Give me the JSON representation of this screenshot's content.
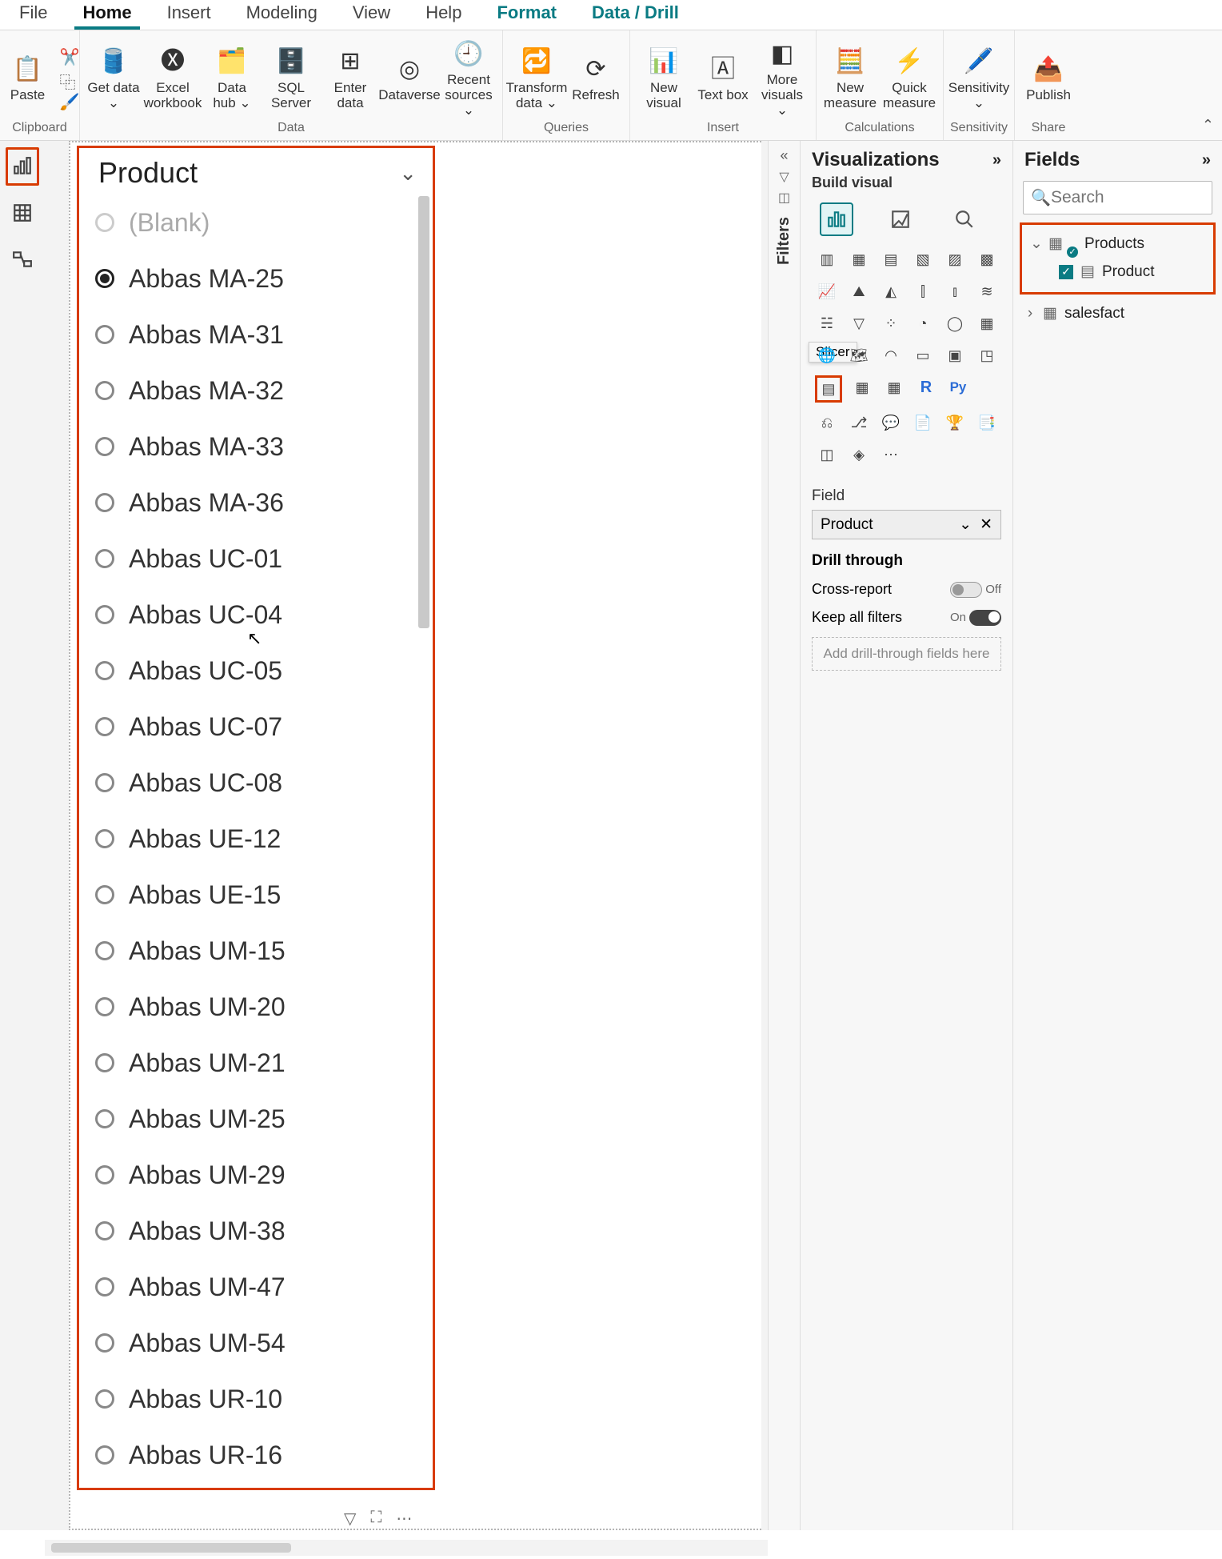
{
  "ribbon": {
    "tabs": [
      "File",
      "Home",
      "Insert",
      "Modeling",
      "View",
      "Help",
      "Format",
      "Data / Drill"
    ],
    "active": "Home",
    "groups": {
      "clipboard": {
        "label": "Clipboard",
        "paste": "Paste"
      },
      "data": {
        "label": "Data",
        "get": "Get data ⌄",
        "excel": "Excel workbook",
        "hub": "Data hub ⌄",
        "sql": "SQL Server",
        "enter": "Enter data",
        "dv": "Dataverse",
        "recent": "Recent sources ⌄"
      },
      "queries": {
        "label": "Queries",
        "transform": "Transform data ⌄",
        "refresh": "Refresh"
      },
      "insert": {
        "label": "Insert",
        "visual": "New visual",
        "text": "Text box",
        "more": "More visuals ⌄"
      },
      "calc": {
        "label": "Calculations",
        "measure": "New measure",
        "quick": "Quick measure"
      },
      "sens": {
        "label": "Sensitivity",
        "btn": "Sensitivity ⌄"
      },
      "share": {
        "label": "Share",
        "publish": "Publish"
      }
    }
  },
  "filters_label": "Filters",
  "viz": {
    "title": "Visualizations",
    "sub": "Build visual",
    "tooltip": "Slicer",
    "field_label": "Field",
    "field_value": "Product",
    "drill_title": "Drill through",
    "cross": "Cross-report",
    "cross_state": "Off",
    "keep": "Keep all filters",
    "keep_state": "On",
    "drop": "Add drill-through fields here"
  },
  "fields": {
    "title": "Fields",
    "search_placeholder": "Search",
    "tables": {
      "products": "Products",
      "product_col": "Product",
      "salesfact": "salesfact"
    }
  },
  "slicer": {
    "title": "Product",
    "items": [
      {
        "label": "(Blank)",
        "blank": true,
        "selected": false
      },
      {
        "label": "Abbas MA-25",
        "selected": true
      },
      {
        "label": "Abbas MA-31",
        "selected": false
      },
      {
        "label": "Abbas MA-32",
        "selected": false
      },
      {
        "label": "Abbas MA-33",
        "selected": false
      },
      {
        "label": "Abbas MA-36",
        "selected": false
      },
      {
        "label": "Abbas UC-01",
        "selected": false
      },
      {
        "label": "Abbas UC-04",
        "selected": false
      },
      {
        "label": "Abbas UC-05",
        "selected": false
      },
      {
        "label": "Abbas UC-07",
        "selected": false
      },
      {
        "label": "Abbas UC-08",
        "selected": false
      },
      {
        "label": "Abbas UE-12",
        "selected": false
      },
      {
        "label": "Abbas UE-15",
        "selected": false
      },
      {
        "label": "Abbas UM-15",
        "selected": false
      },
      {
        "label": "Abbas UM-20",
        "selected": false
      },
      {
        "label": "Abbas UM-21",
        "selected": false
      },
      {
        "label": "Abbas UM-25",
        "selected": false
      },
      {
        "label": "Abbas UM-29",
        "selected": false
      },
      {
        "label": "Abbas UM-38",
        "selected": false
      },
      {
        "label": "Abbas UM-47",
        "selected": false
      },
      {
        "label": "Abbas UM-54",
        "selected": false
      },
      {
        "label": "Abbas UR-10",
        "selected": false
      },
      {
        "label": "Abbas UR-16",
        "selected": false
      }
    ]
  }
}
